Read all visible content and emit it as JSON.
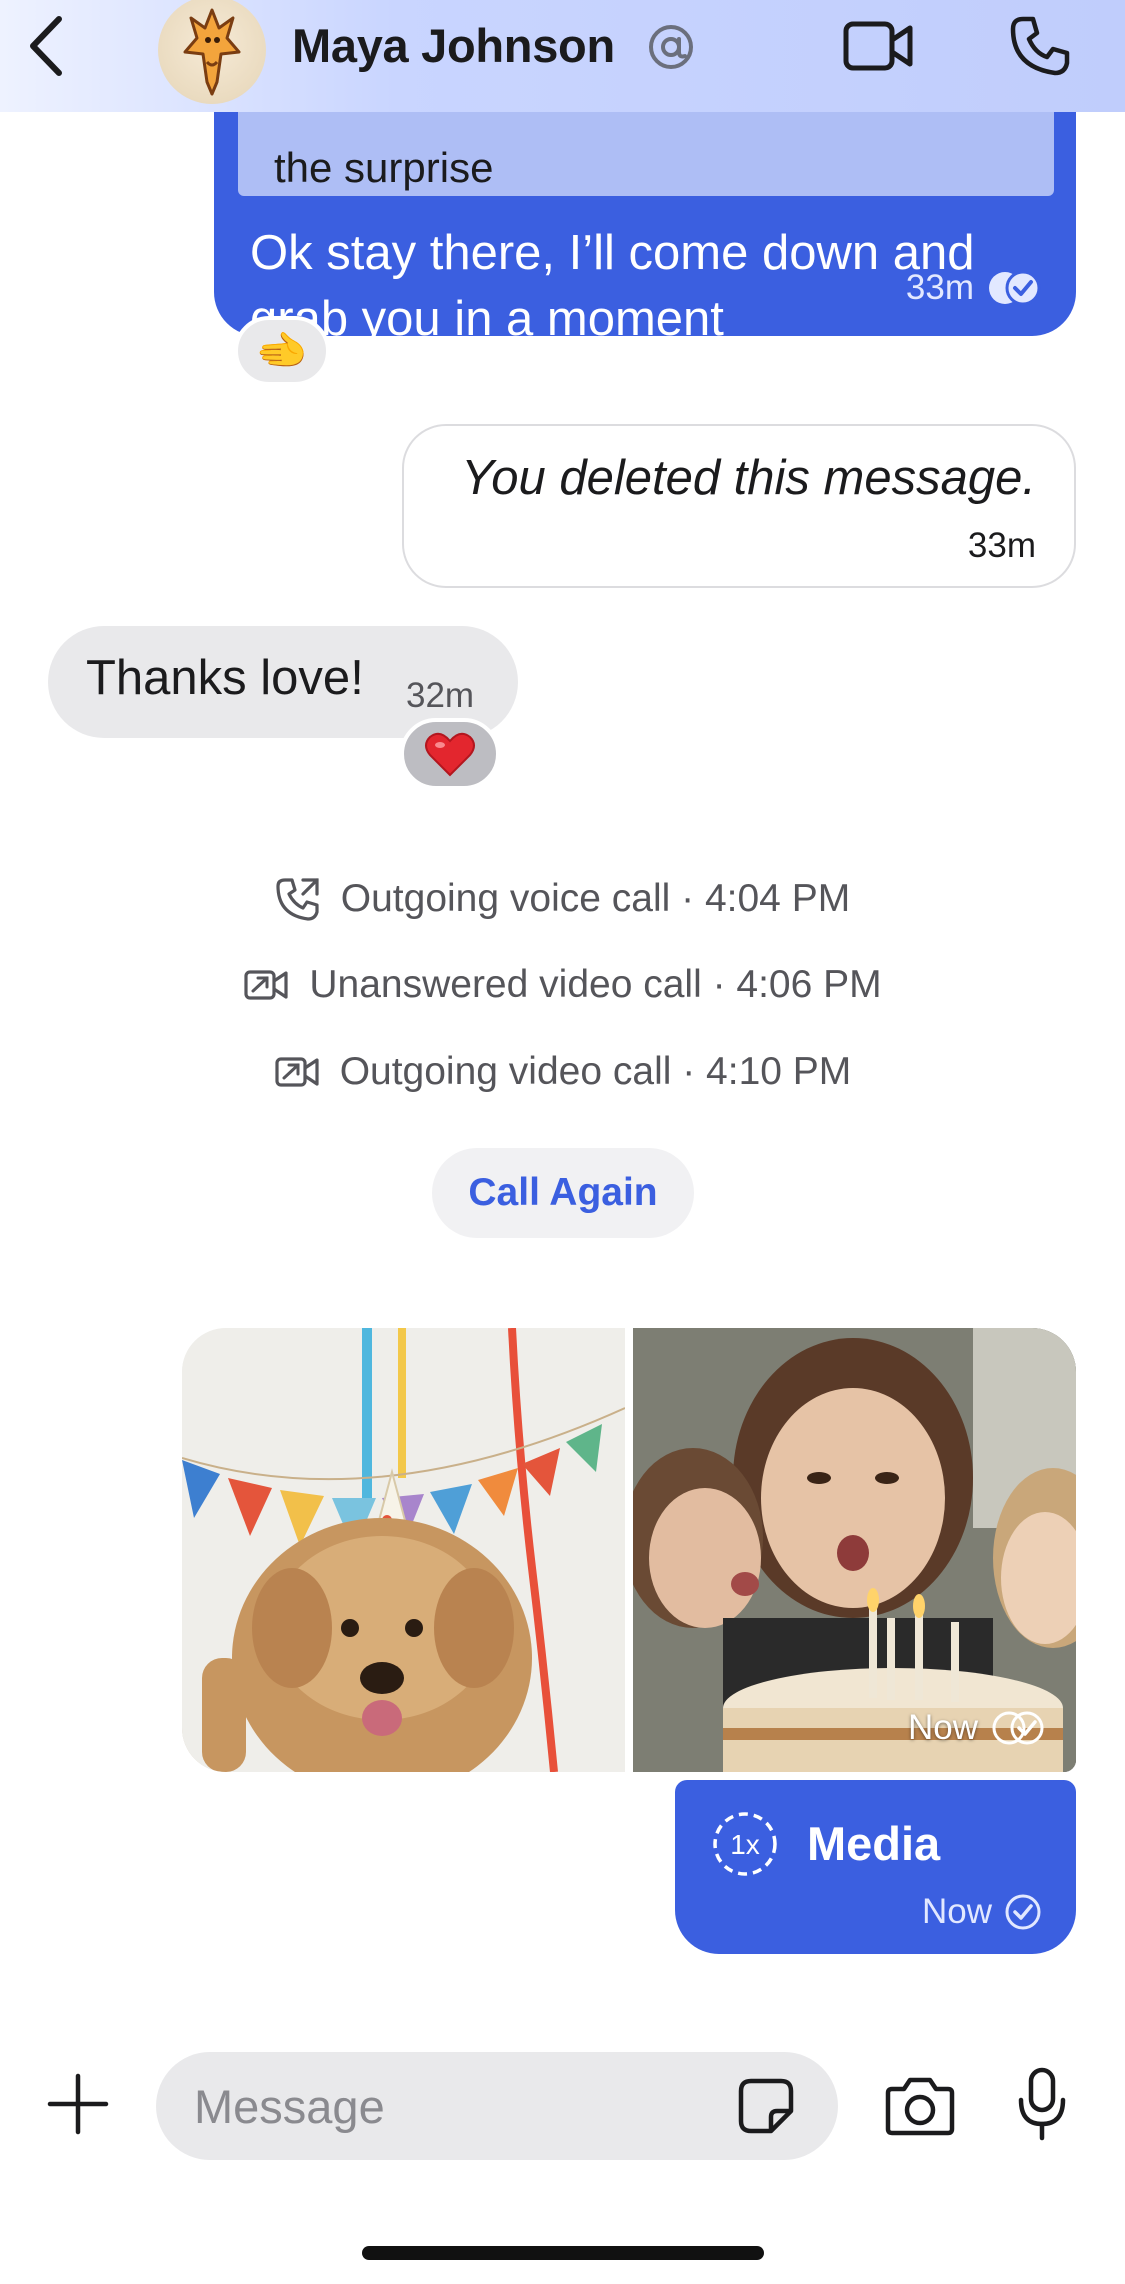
{
  "header": {
    "contact_name": "Maya Johnson",
    "icons": {
      "back": "chevron-left-icon",
      "mention": "at-sign-icon",
      "video": "video-camera-icon",
      "call": "phone-icon"
    }
  },
  "messages": {
    "outgoing_1": {
      "quote_text": "the surprise",
      "text": "Ok stay there, I’ll come down and grab you in a moment",
      "time": "33m",
      "reaction": "🫲"
    },
    "deleted": {
      "text": "You deleted this message.",
      "time": "33m"
    },
    "incoming_1": {
      "text": "Thanks love!",
      "time": "32m",
      "reaction": "❤️"
    }
  },
  "call_log": [
    {
      "label": "Outgoing voice call · 4:04 PM",
      "icon": "outgoing-call-icon"
    },
    {
      "label": "Unanswered video call · 4:06 PM",
      "icon": "video-call-icon"
    },
    {
      "label": "Outgoing video call · 4:10 PM",
      "icon": "video-call-icon"
    }
  ],
  "call_again_label": "Call Again",
  "media": {
    "photos_time": "Now",
    "view_once_badge": "1x",
    "label": "Media",
    "time": "Now"
  },
  "composer": {
    "placeholder": "Message",
    "icons": {
      "add": "plus-icon",
      "sticker": "sticker-icon",
      "camera": "camera-icon",
      "mic": "microphone-icon"
    }
  },
  "colors": {
    "accent": "#3b5fe0",
    "bubble_incoming": "#e9e9eb",
    "header_tint": "#c0cdfc",
    "quote": "#aebef5"
  }
}
